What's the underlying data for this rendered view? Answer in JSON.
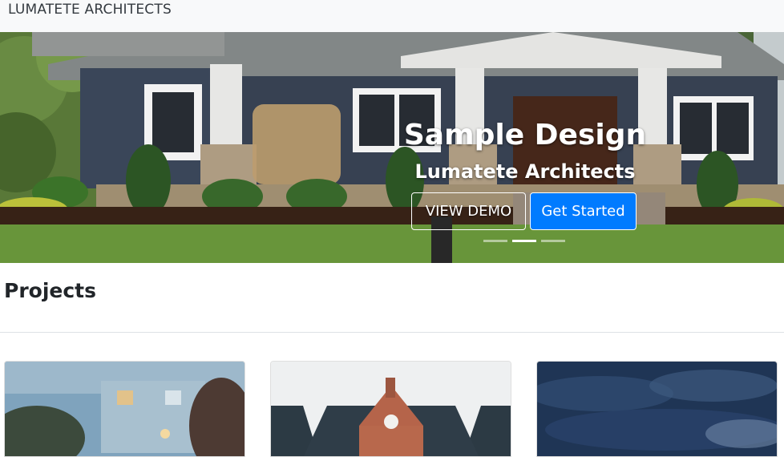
{
  "navbar": {
    "brand": "LUMATETE ARCHITECTS"
  },
  "hero": {
    "title": "Sample Design",
    "subtitle": "Lumatete Architects",
    "view_demo_label": "VIEW DEMO",
    "get_started_label": "Get Started",
    "slides": 3,
    "active_slide": 2
  },
  "projects": {
    "title": "Projects",
    "cards": 3
  },
  "colors": {
    "navbar_bg": "#f8f9fa",
    "primary": "#007bff",
    "divider": "#dee2e6"
  }
}
